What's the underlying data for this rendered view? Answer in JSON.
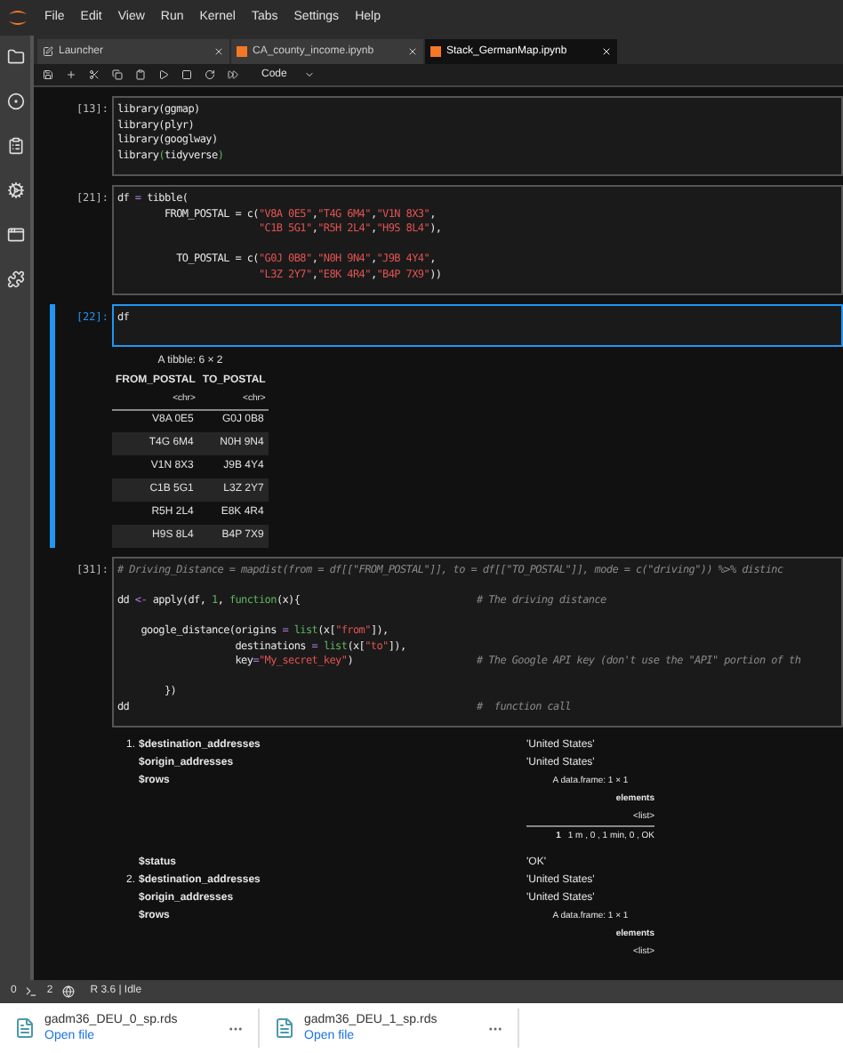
{
  "menu": [
    "File",
    "Edit",
    "View",
    "Run",
    "Kernel",
    "Tabs",
    "Settings",
    "Help"
  ],
  "tabs": [
    {
      "label": "Launcher",
      "kind": "launcher",
      "selected": false
    },
    {
      "label": "CA_county_income.ipynb",
      "kind": "notebook",
      "selected": false
    },
    {
      "label": "Stack_GermanMap.ipynb",
      "kind": "notebook",
      "selected": true
    }
  ],
  "toolbar": {
    "cell_type": "Code"
  },
  "cells": [
    {
      "prompt": "[13]:",
      "selected": false,
      "lines": [
        {
          "tokens": [
            {
              "t": "library(ggmap)",
              "kind": "plain"
            }
          ]
        },
        {
          "tokens": [
            {
              "t": "library(plyr)",
              "kind": "plain"
            }
          ]
        },
        {
          "tokens": [
            {
              "t": "library(googlway)",
              "kind": "plain"
            }
          ]
        },
        {
          "tokens": [
            {
              "t": "library",
              "kind": "plain"
            },
            {
              "t": "(",
              "kind": "builtin"
            },
            {
              "t": "tidyverse",
              "kind": "plain"
            },
            {
              "t": ")",
              "kind": "builtin"
            }
          ]
        }
      ]
    },
    {
      "prompt": "[21]:",
      "selected": false,
      "lines": [
        {
          "tokens": [
            {
              "t": "df",
              "kind": "plain"
            },
            {
              "t": " = ",
              "kind": "op"
            },
            {
              "t": "tibble(",
              "kind": "plain"
            }
          ]
        },
        {
          "tokens": [
            {
              "t": "        FROM_POSTAL = c(",
              "kind": "plain"
            },
            {
              "t": "\"V8A 0E5\"",
              "kind": "string"
            },
            {
              "t": ",",
              "kind": "plain"
            },
            {
              "t": "\"T4G 6M4\"",
              "kind": "string"
            },
            {
              "t": ",",
              "kind": "plain"
            },
            {
              "t": "\"V1N 8X3\"",
              "kind": "string"
            },
            {
              "t": ",",
              "kind": "plain"
            }
          ]
        },
        {
          "tokens": [
            {
              "t": "                        \"C1B 5G1\"",
              "kind": "string"
            },
            {
              "t": ",",
              "kind": "plain"
            },
            {
              "t": "\"R5H 2L4\"",
              "kind": "string"
            },
            {
              "t": ",",
              "kind": "plain"
            },
            {
              "t": "\"H9S 8L4\"",
              "kind": "string"
            },
            {
              "t": "),",
              "kind": "plain"
            }
          ]
        },
        {
          "space_before": true,
          "tokens": [
            {
              "t": "          TO_POSTAL = c(",
              "kind": "plain"
            },
            {
              "t": "\"G0J 0B8\"",
              "kind": "string"
            },
            {
              "t": ",",
              "kind": "plain"
            },
            {
              "t": "\"N0H 9N4\"",
              "kind": "string"
            },
            {
              "t": ",",
              "kind": "plain"
            },
            {
              "t": "\"J9B 4Y4\"",
              "kind": "string"
            },
            {
              "t": ",",
              "kind": "plain"
            }
          ]
        },
        {
          "tokens": [
            {
              "t": "                        \"L3Z 2Y7\"",
              "kind": "string"
            },
            {
              "t": ",",
              "kind": "plain"
            },
            {
              "t": "\"E8K 4R4\"",
              "kind": "string"
            },
            {
              "t": ",",
              "kind": "plain"
            },
            {
              "t": "\"B4P 7X9\"",
              "kind": "string"
            },
            {
              "t": "))",
              "kind": "plain"
            }
          ]
        }
      ]
    },
    {
      "prompt": "[22]:",
      "selected": true,
      "lines": [
        {
          "tokens": [
            {
              "t": "df",
              "kind": "plain"
            }
          ]
        }
      ],
      "output": {
        "caption": "A tibble: 6 × 2",
        "columns": [
          "FROM_POSTAL",
          "TO_POSTAL"
        ],
        "types": [
          "<chr>",
          "<chr>"
        ],
        "rows": [
          [
            "V8A 0E5",
            "G0J 0B8"
          ],
          [
            "T4G 6M4",
            "N0H 9N4"
          ],
          [
            "V1N 8X3",
            "J9B 4Y4"
          ],
          [
            "C1B 5G1",
            "L3Z 2Y7"
          ],
          [
            "R5H 2L4",
            "E8K 4R4"
          ],
          [
            "H9S 8L4",
            "B4P 7X9"
          ]
        ]
      }
    },
    {
      "prompt": "[31]:",
      "selected": false,
      "lines": [
        {
          "tokens": [
            {
              "t": "# Driving_Distance = mapdist(from = df[[\"FROM_POSTAL\"]], to = df[[\"TO_POSTAL\"]], mode = c(\"driving\")) %>% distinc",
              "kind": "comment"
            }
          ]
        },
        {
          "space_before": true,
          "tokens": [
            {
              "t": "dd",
              "kind": "plain"
            },
            {
              "t": " <- ",
              "kind": "op"
            },
            {
              "t": "apply(df, ",
              "kind": "plain"
            },
            {
              "t": "1",
              "kind": "builtin"
            },
            {
              "t": ", ",
              "kind": "plain"
            },
            {
              "t": "function",
              "kind": "builtin"
            },
            {
              "t": "(x){",
              "kind": "plain"
            }
          ],
          "comment": "# The driving distance"
        },
        {
          "space_before": true,
          "tokens": [
            {
              "t": "    google_distance(origins",
              "kind": "plain"
            },
            {
              "t": " = ",
              "kind": "op"
            },
            {
              "t": "list",
              "kind": "builtin"
            },
            {
              "t": "(x[",
              "kind": "plain"
            },
            {
              "t": "\"from\"",
              "kind": "string"
            },
            {
              "t": "]),",
              "kind": "plain"
            }
          ]
        },
        {
          "tokens": [
            {
              "t": "                    destinations",
              "kind": "plain"
            },
            {
              "t": " = ",
              "kind": "op"
            },
            {
              "t": "list",
              "kind": "builtin"
            },
            {
              "t": "(x[",
              "kind": "plain"
            },
            {
              "t": "\"to\"",
              "kind": "string"
            },
            {
              "t": "]),",
              "kind": "plain"
            }
          ]
        },
        {
          "tokens": [
            {
              "t": "                    key",
              "kind": "plain"
            },
            {
              "t": "=",
              "kind": "op"
            },
            {
              "t": "\"My_secret_key\"",
              "kind": "string"
            },
            {
              "t": ")",
              "kind": "plain"
            }
          ],
          "comment": "# The Google API key (don't use the \"API\" portion of th"
        },
        {
          "space_before": true,
          "tokens": [
            {
              "t": "        })",
              "kind": "plain"
            }
          ]
        },
        {
          "tokens": [
            {
              "t": "dd",
              "kind": "plain"
            }
          ],
          "comment": "#  function call"
        }
      ]
    }
  ],
  "result": [
    {
      "number": "1.",
      "fields": [
        {
          "key": "$destination_addresses",
          "kind": "text",
          "value": "'United States'"
        },
        {
          "key": "$origin_addresses",
          "kind": "text",
          "value": "'United States'"
        },
        {
          "key": "$rows",
          "kind": "frame",
          "caption": "A data.frame: 1 × 1",
          "header": "elements",
          "type": "<list>",
          "rows": [
            [
              "1",
              "1 m , 0 , 1 min, 0 , OK"
            ]
          ]
        },
        {
          "key": "$status",
          "kind": "text",
          "value": "'OK'"
        }
      ]
    },
    {
      "number": "2.",
      "fields": [
        {
          "key": "$destination_addresses",
          "kind": "text",
          "value": "'United States'"
        },
        {
          "key": "$origin_addresses",
          "kind": "text",
          "value": "'United States'"
        },
        {
          "key": "$rows",
          "kind": "frame",
          "caption": "A data.frame: 1 × 1",
          "header": "elements",
          "type": "<list>"
        }
      ]
    }
  ],
  "status_bar": {
    "terminals": "0",
    "kernels": "2",
    "kernel": "R 3.6 | Idle"
  },
  "downloads": [
    {
      "name": "gadm36_DEU_0_sp.rds",
      "action": "Open file"
    },
    {
      "name": "gadm36_DEU_1_sp.rds",
      "action": "Open file"
    }
  ]
}
